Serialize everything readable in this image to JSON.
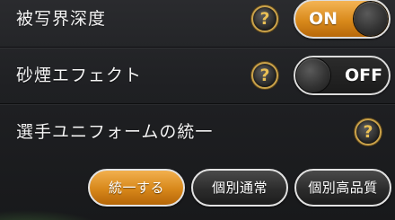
{
  "settings": {
    "depth_of_field": {
      "label": "被写界深度",
      "help": "?",
      "toggle_state": "ON"
    },
    "dust_effect": {
      "label": "砂煙エフェクト",
      "help": "?",
      "toggle_state": "OFF"
    },
    "uniform_unify": {
      "label": "選手ユニフォームの統一",
      "help": "?",
      "options": [
        "統一する",
        "個別通常",
        "個別高品質"
      ],
      "selected": "統一する"
    }
  },
  "colors": {
    "accent_orange": "#d98a1c",
    "help_gold": "#caa24a",
    "background": "#1f2023"
  }
}
